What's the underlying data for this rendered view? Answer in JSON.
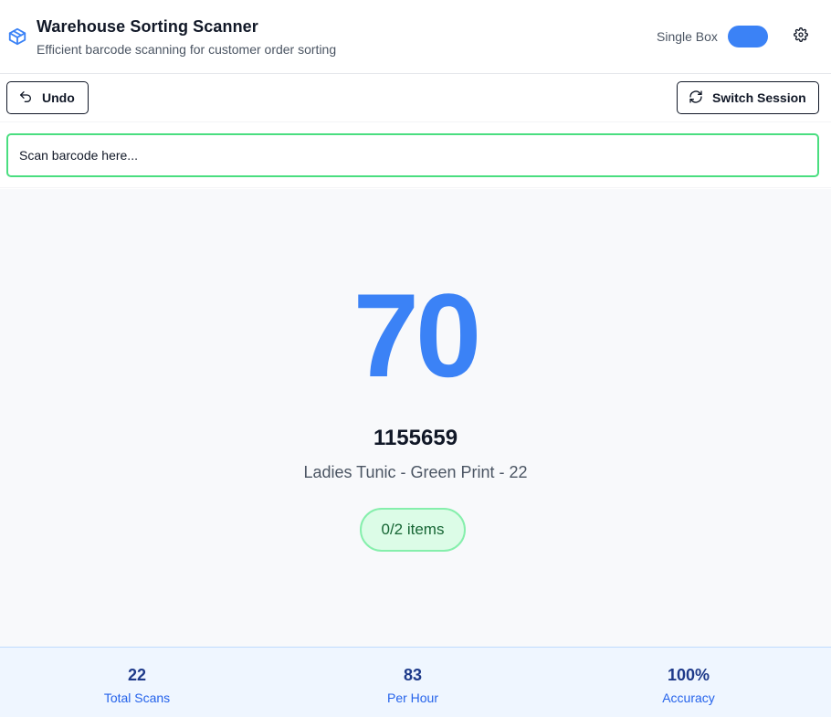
{
  "header": {
    "title": "Warehouse Sorting Scanner",
    "subtitle": "Efficient barcode scanning for customer order sorting",
    "logo_icon": "package-box-icon",
    "mode_label": "Single Box",
    "mode_toggle_on": true,
    "settings_icon": "gear-icon"
  },
  "toolbar": {
    "undo_label": "Undo",
    "undo_icon": "undo-arrow-icon",
    "switch_label": "Switch Session",
    "switch_icon": "refresh-icon"
  },
  "scan": {
    "placeholder": "Scan barcode here...",
    "value": ""
  },
  "current_item": {
    "box_number": "70",
    "sku": "1155659",
    "product_name": "Ladies Tunic - Green Print - 22",
    "progress": "0/2 items"
  },
  "stats": [
    {
      "value": "22",
      "label": "Total Scans"
    },
    {
      "value": "83",
      "label": "Per Hour"
    },
    {
      "value": "100%",
      "label": "Accuracy"
    }
  ],
  "colors": {
    "accent": "#3b82f6",
    "success_border": "#4ade80",
    "progress_bg": "#dcfce7",
    "stats_bg": "#eff6ff"
  }
}
